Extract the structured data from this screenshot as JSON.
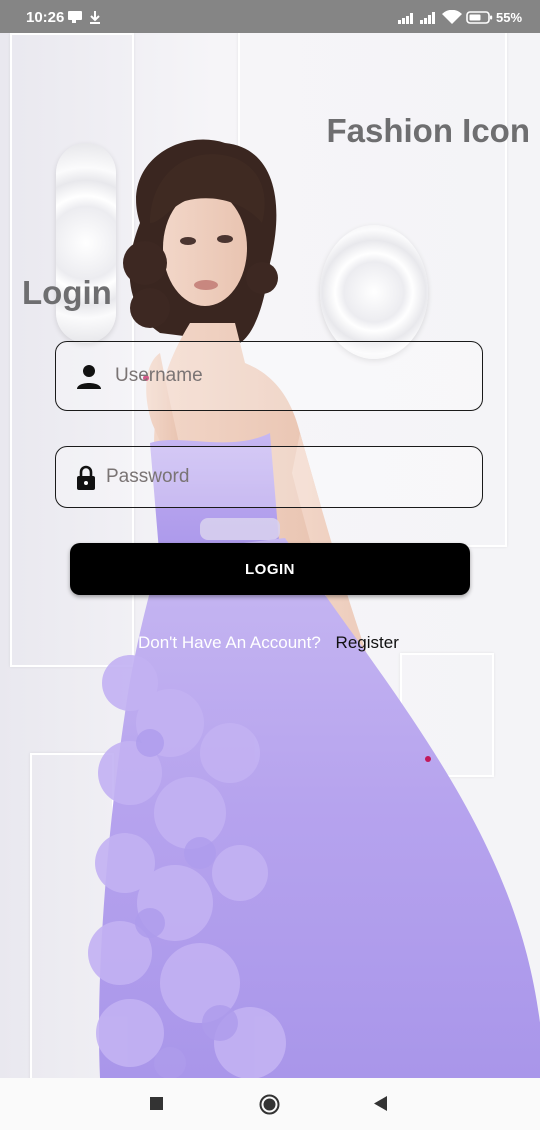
{
  "status_bar": {
    "time": "10:26",
    "battery_percent": "55%",
    "icons": [
      "chat-notification-icon",
      "download-icon",
      "signal-icon",
      "signal-2-icon",
      "wifi-icon",
      "battery-icon"
    ]
  },
  "app": {
    "brand_title": "Fashion Icon",
    "heading": "Login"
  },
  "form": {
    "username_placeholder": "Username",
    "username_value": "",
    "password_placeholder": "Password",
    "password_value": "",
    "login_button_label": "LOGIN",
    "register_prompt": "Don't Have An Account?",
    "register_link": "Register"
  },
  "nav_bar": {
    "buttons": [
      "recents-square-icon",
      "home-circle-icon",
      "back-triangle-icon"
    ]
  },
  "colors": {
    "status_bar_bg": "#858585",
    "heading_text": "#6e6e70",
    "button_bg": "#000000",
    "dress": "#b9a7ee"
  }
}
